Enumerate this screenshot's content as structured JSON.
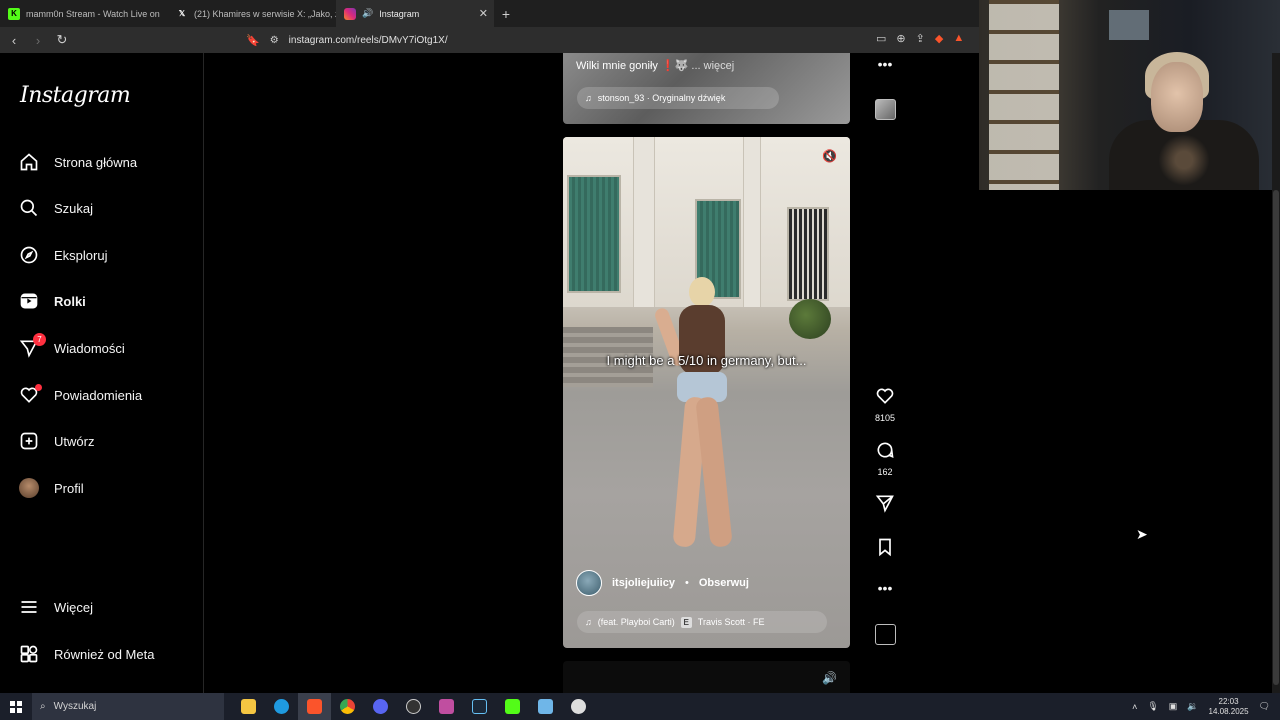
{
  "browser": {
    "tabs": [
      {
        "title": "mamm0n Stream - Watch Live on",
        "favicon": "K",
        "favicon_color": "#53fc18"
      },
      {
        "title": "(21) Khamires w serwisie X: „Jako, ze",
        "favicon": "X",
        "favicon_color": "#000000"
      },
      {
        "title": "Instagram",
        "favicon": "ig",
        "favicon_color": "#e1306c",
        "active": true
      }
    ],
    "new_tab_label": "+",
    "url": "instagram.com/reels/DMvY7iOtg1X/"
  },
  "instagram": {
    "logo": "Instagram",
    "nav": [
      {
        "label": "Strona główna",
        "icon": "home-icon"
      },
      {
        "label": "Szukaj",
        "icon": "search-icon"
      },
      {
        "label": "Eksploruj",
        "icon": "compass-icon"
      },
      {
        "label": "Rolki",
        "icon": "reels-icon",
        "active": true
      },
      {
        "label": "Wiadomości",
        "icon": "messages-icon",
        "badge": "7"
      },
      {
        "label": "Powiadomienia",
        "icon": "heart-icon"
      },
      {
        "label": "Utwórz",
        "icon": "plus-square-icon"
      },
      {
        "label": "Profil",
        "icon": "avatar"
      }
    ],
    "more": "Więcej",
    "meta": "Również od Meta"
  },
  "prev_reel": {
    "caption": "Wilki mnie goniły ❗🐺",
    "more": "... więcej",
    "audio": "stonson_93 · Oryginalny dźwięk"
  },
  "reel": {
    "overlay_text": "I might be a 5/10 in germany, but...",
    "username": "itsjoliejuiicy",
    "separator": "•",
    "follow": "Obserwuj",
    "audio_feat": "(feat. Playboi Carti)",
    "explicit": "E",
    "audio_artist": "Travis Scott · FE",
    "likes": "8105",
    "comments": "162"
  },
  "taskbar": {
    "search_placeholder": "Wyszukaj",
    "time": "22:03",
    "date": "14.08.2025"
  }
}
